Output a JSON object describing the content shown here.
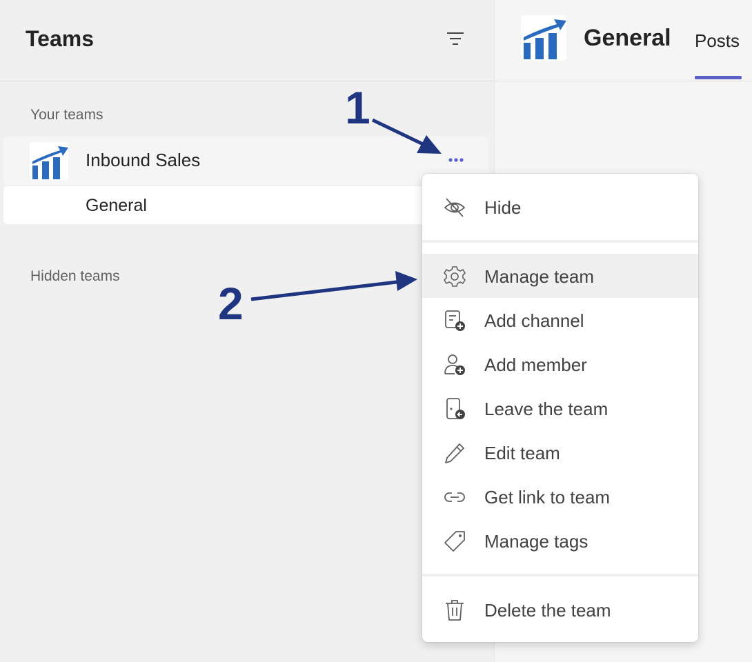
{
  "sidebar": {
    "title": "Teams",
    "your_teams_label": "Your teams",
    "hidden_teams_label": "Hidden teams",
    "team": {
      "name": "Inbound Sales",
      "channel": "General"
    }
  },
  "main": {
    "channel_title": "General",
    "tab_posts": "Posts"
  },
  "menu": {
    "items": [
      {
        "label": "Hide",
        "icon": "eye-off-icon"
      },
      {
        "label": "Manage team",
        "icon": "gear-icon"
      },
      {
        "label": "Add channel",
        "icon": "add-channel-icon"
      },
      {
        "label": "Add member",
        "icon": "add-member-icon"
      },
      {
        "label": "Leave the team",
        "icon": "leave-team-icon"
      },
      {
        "label": "Edit team",
        "icon": "pencil-icon"
      },
      {
        "label": "Get link to team",
        "icon": "link-icon"
      },
      {
        "label": "Manage tags",
        "icon": "tag-icon"
      },
      {
        "label": "Delete the team",
        "icon": "trash-icon"
      }
    ]
  },
  "annotations": {
    "step1": "1",
    "step2": "2"
  },
  "colors": {
    "accent": "#5b5fc7",
    "annotation": "#1f3580",
    "logo": "#2a6bbf"
  }
}
